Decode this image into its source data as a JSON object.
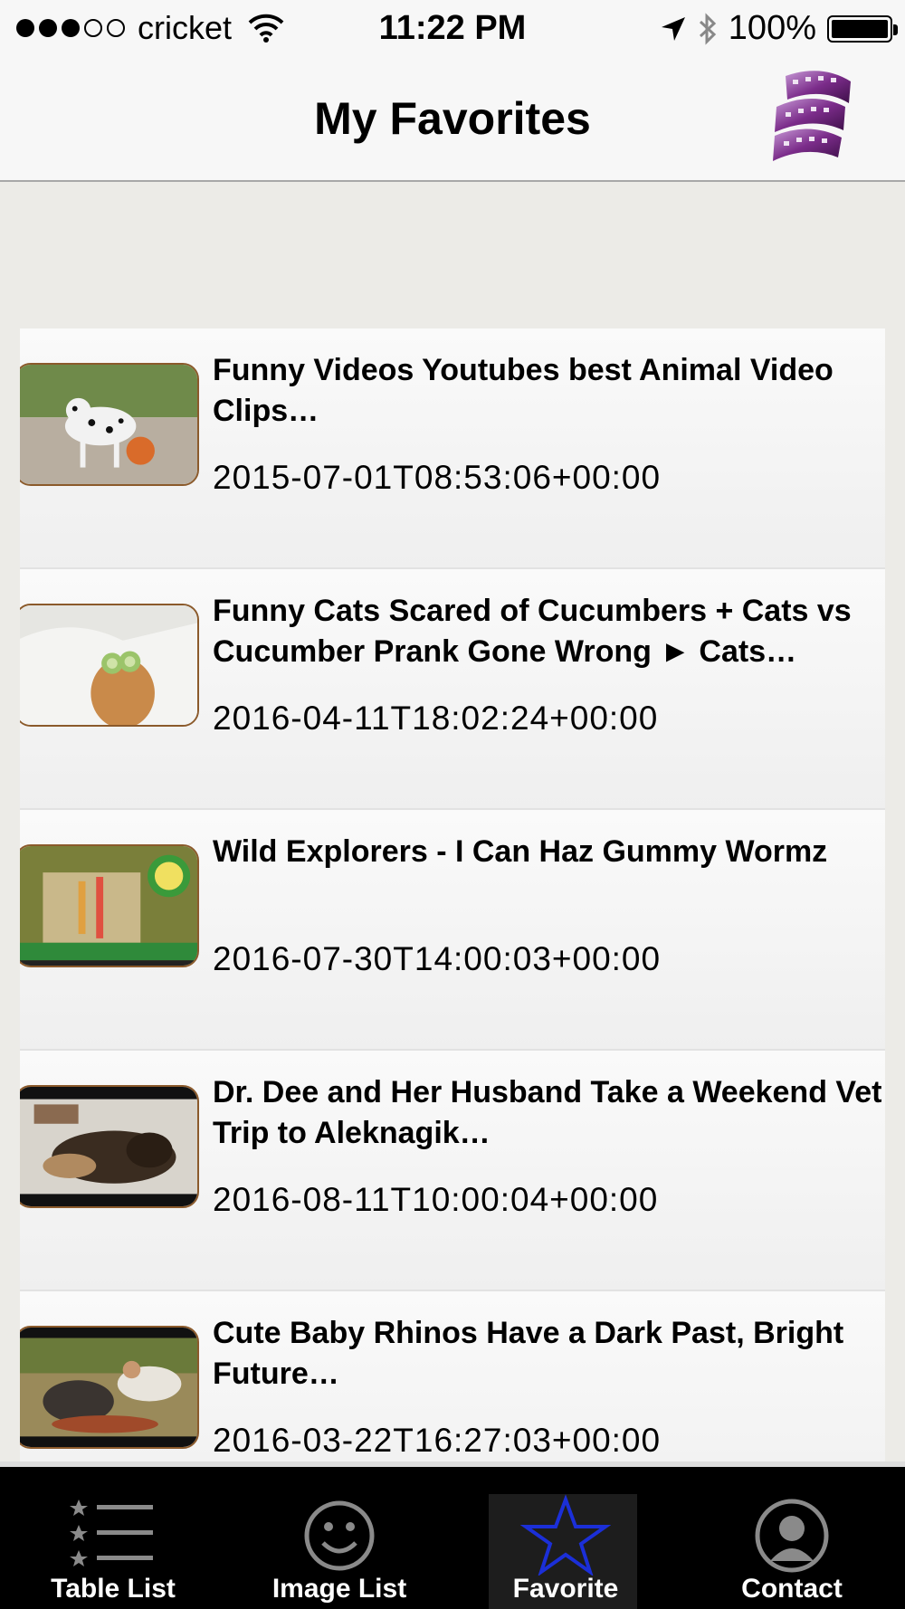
{
  "status_bar": {
    "carrier": "cricket",
    "time": "11:22 PM",
    "battery": "100%",
    "signal_bars_filled": 3,
    "signal_bars_total": 5
  },
  "nav": {
    "title": "My Favorites",
    "logo_icon": "film-reel-icon"
  },
  "videos": [
    {
      "title": "Funny Videos Youtubes best Animal Video Clips…",
      "date": "2015-07-01T08:53:06+00:00",
      "thumb": "dalmatian-basketball"
    },
    {
      "title": "Funny Cats Scared of Cucumbers + Cats vs Cucumber Prank Gone Wrong ► Cats…",
      "date": "2016-04-11T18:02:24+00:00",
      "thumb": "cat-cucumber"
    },
    {
      "title": "Wild Explorers - I Can Haz Gummy Wormz",
      "date": "2016-07-30T14:00:03+00:00",
      "thumb": "gummy-worms"
    },
    {
      "title": "Dr. Dee and Her Husband Take a Weekend Vet Trip to Aleknagik…",
      "date": "2016-08-11T10:00:04+00:00",
      "thumb": "dog-vet"
    },
    {
      "title": "Cute Baby Rhinos Have a Dark Past, Bright Future…",
      "date": "2016-03-22T16:27:03+00:00",
      "thumb": "baby-rhino"
    }
  ],
  "tabs": [
    {
      "label": "Table List",
      "icon": "list-icon",
      "active": false
    },
    {
      "label": "Image List",
      "icon": "smiley-icon",
      "active": false
    },
    {
      "label": "Favorite",
      "icon": "star-icon",
      "active": true
    },
    {
      "label": "Contact",
      "icon": "person-icon",
      "active": false
    }
  ],
  "colors": {
    "tab_active": "#1b2fd8",
    "tab_inactive": "#8a8a8a",
    "thumb_border": "#8b5a2b",
    "tab_bar_bg": "#000000"
  }
}
